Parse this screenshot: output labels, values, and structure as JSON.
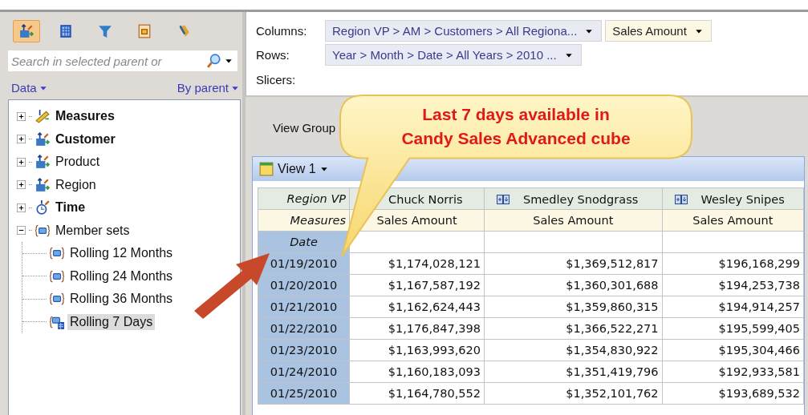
{
  "toolbar": {
    "buttons": [
      {
        "kind": "dimension",
        "selected": true
      },
      {
        "kind": "calculator",
        "selected": false
      },
      {
        "kind": "filter",
        "selected": false
      },
      {
        "kind": "frame",
        "selected": false
      },
      {
        "kind": "brush",
        "selected": false
      }
    ]
  },
  "search": {
    "placeholder": "Search in selected parent or"
  },
  "panel_menus": [
    {
      "label": "Data"
    },
    {
      "label": "By parent"
    }
  ],
  "tree": [
    {
      "label": "Measures",
      "kind": "measures",
      "bold": true,
      "expanded": false,
      "selected": false
    },
    {
      "label": "Customer",
      "kind": "dimension",
      "bold": true,
      "expanded": false,
      "selected": false
    },
    {
      "label": "Product",
      "kind": "dimension",
      "bold": false,
      "expanded": false,
      "selected": false
    },
    {
      "label": "Region",
      "kind": "dimension",
      "bold": false,
      "expanded": false,
      "selected": false
    },
    {
      "label": "Time",
      "kind": "time",
      "bold": true,
      "expanded": false,
      "selected": false
    },
    {
      "label": "Member sets",
      "kind": "set",
      "bold": false,
      "expanded": true,
      "selected": false,
      "children": [
        {
          "label": "Rolling 12 Months",
          "kind": "set",
          "bold": false,
          "selected": false
        },
        {
          "label": "Rolling 24 Months",
          "kind": "set",
          "bold": false,
          "selected": false
        },
        {
          "label": "Rolling 36 Months",
          "kind": "set",
          "bold": false,
          "selected": false
        },
        {
          "label": "Rolling 7 Days",
          "kind": "calc-set",
          "bold": false,
          "selected": true
        }
      ]
    }
  ],
  "layout_rows": [
    {
      "label": "Columns:",
      "chips": [
        {
          "text": "Region VP > AM > Customers > All Regiona...",
          "kind": "dimension"
        },
        {
          "text": "Sales Amount",
          "kind": "measure"
        }
      ]
    },
    {
      "label": "Rows:",
      "chips": [
        {
          "text": "Year > Month > Date > All Years > 2010 ...",
          "kind": "dimension"
        }
      ]
    },
    {
      "label": "Slicers:",
      "chips": []
    }
  ],
  "view_group": {
    "label": "View Group"
  },
  "view": {
    "title": "View 1"
  },
  "table": {
    "corner": [
      "Region VP",
      "Measures",
      "Date"
    ],
    "columns": [
      {
        "name": "Chuck Norris",
        "measure": "Sales Amount"
      },
      {
        "name": "Smedley Snodgrass",
        "measure": "Sales Amount"
      },
      {
        "name": "Wesley Snipes",
        "measure": "Sales Amount"
      }
    ],
    "rows": [
      {
        "date": "01/19/2010",
        "values": [
          "$1,174,028,121",
          "$1,369,512,817",
          "$196,168,299"
        ]
      },
      {
        "date": "01/20/2010",
        "values": [
          "$1,167,587,192",
          "$1,360,301,688",
          "$194,253,738"
        ]
      },
      {
        "date": "01/21/2010",
        "values": [
          "$1,162,624,443",
          "$1,359,860,315",
          "$194,914,257"
        ]
      },
      {
        "date": "01/22/2010",
        "values": [
          "$1,176,847,398",
          "$1,366,522,271",
          "$195,599,405"
        ]
      },
      {
        "date": "01/23/2010",
        "values": [
          "$1,163,993,620",
          "$1,354,830,922",
          "$195,304,466"
        ]
      },
      {
        "date": "01/24/2010",
        "values": [
          "$1,160,183,093",
          "$1,351,419,796",
          "$192,933,581"
        ]
      },
      {
        "date": "01/25/2010",
        "values": [
          "$1,164,780,552",
          "$1,352,101,762",
          "$193,689,532"
        ]
      }
    ]
  },
  "callout": {
    "lines": [
      "Last 7 days available in",
      "Candy Sales Advanced cube"
    ]
  }
}
